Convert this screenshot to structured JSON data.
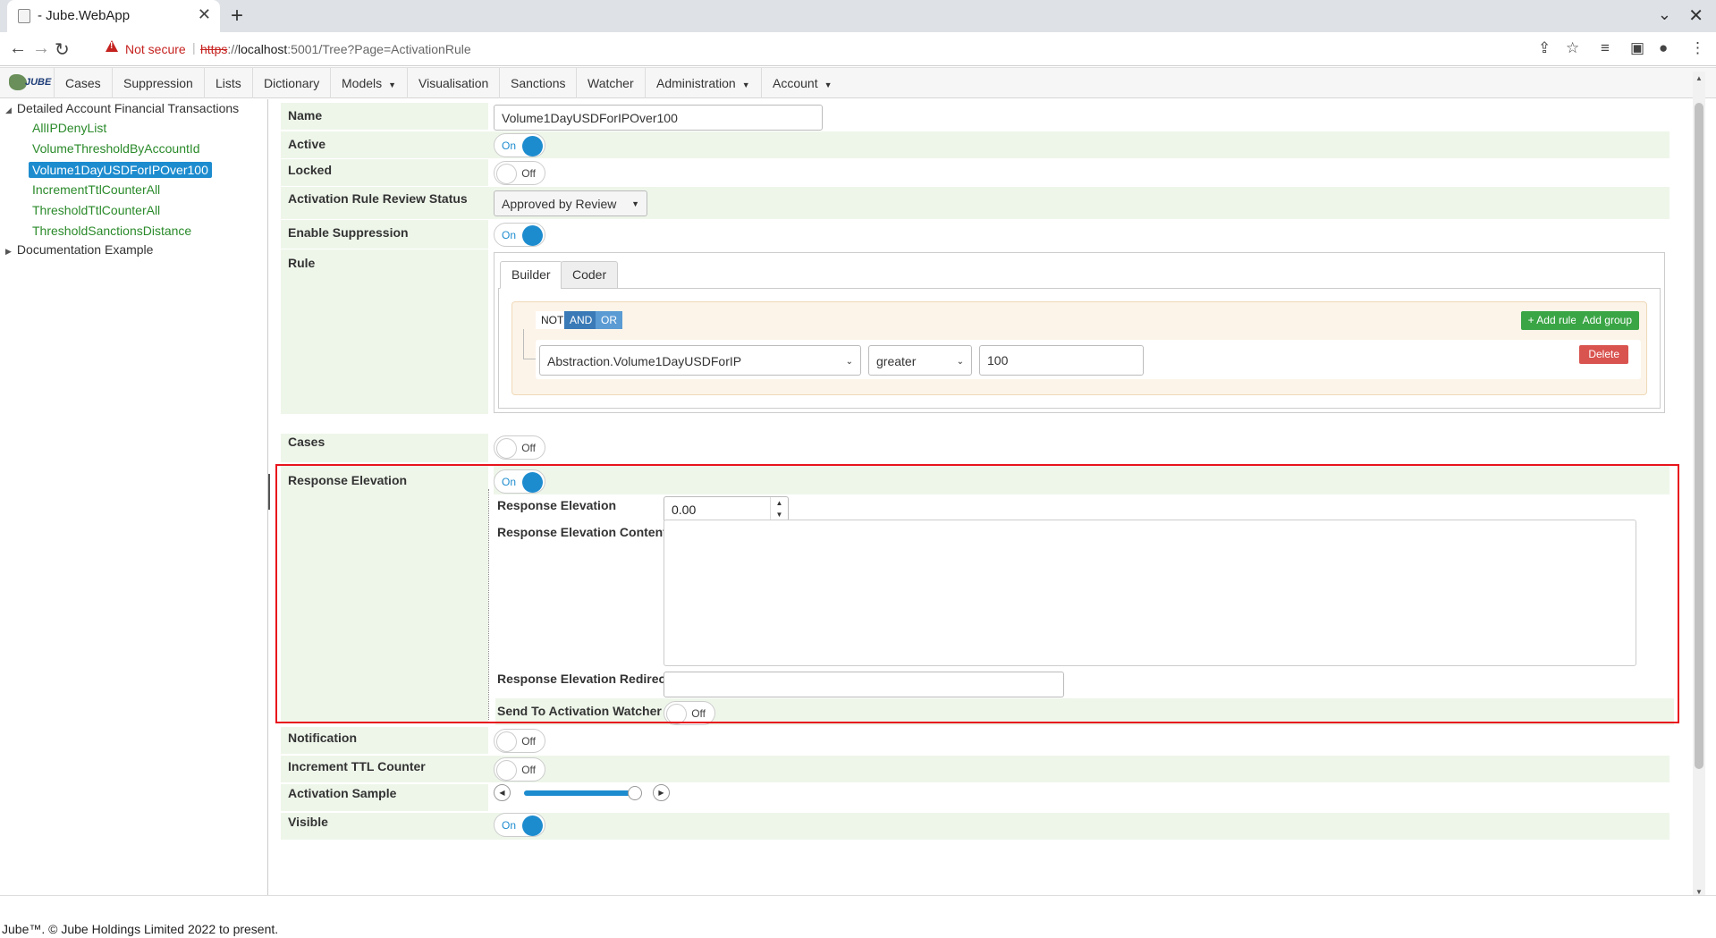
{
  "browser": {
    "tab_title": "- Jube.WebApp",
    "not_secure": "Not secure",
    "url_scheme": "https",
    "url_sep": "://",
    "url_host": "localhost",
    "url_rest": ":5001/Tree?Page=ActivationRule"
  },
  "app": {
    "logo_text": "JUBE",
    "menu": [
      {
        "label": "Cases",
        "dropdown": false
      },
      {
        "label": "Suppression",
        "dropdown": false
      },
      {
        "label": "Lists",
        "dropdown": false
      },
      {
        "label": "Dictionary",
        "dropdown": false
      },
      {
        "label": "Models",
        "dropdown": true
      },
      {
        "label": "Visualisation",
        "dropdown": false
      },
      {
        "label": "Sanctions",
        "dropdown": false
      },
      {
        "label": "Watcher",
        "dropdown": false
      },
      {
        "label": "Administration",
        "dropdown": true
      },
      {
        "label": "Account",
        "dropdown": true
      }
    ]
  },
  "tree": {
    "parent1": "Detailed Account Financial Transactions",
    "items": [
      "AllIPDenyList",
      "VolumeThresholdByAccountId",
      "Volume1DayUSDForIPOver100",
      "IncrementTtlCounterAll",
      "ThresholdTtlCounterAll",
      "ThresholdSanctionsDistance"
    ],
    "selected_index": 2,
    "parent2": "Documentation Example"
  },
  "form": {
    "name_label": "Name",
    "name_value": "Volume1DayUSDForIPOver100",
    "active_label": "Active",
    "locked_label": "Locked",
    "review_label": "Activation Rule Review Status",
    "review_value": "Approved by Review",
    "suppression_label": "Enable Suppression",
    "rule_label": "Rule",
    "builder_tab": "Builder",
    "coder_tab": "Coder",
    "qb_not": "NOT",
    "qb_and": "AND",
    "qb_or": "OR",
    "qb_add_rule": "+ Add rule",
    "qb_add_group": "Add group",
    "qb_field": "Abstraction.Volume1DayUSDForIP",
    "qb_operator": "greater",
    "qb_value": "100",
    "qb_delete": "Delete",
    "cases_label": "Cases",
    "response_elevation_label": "Response Elevation",
    "response_elevation_sub_label": "Response Elevation",
    "response_elevation_value": "0.00",
    "response_elevation_content_label": "Response Elevation Content",
    "response_elevation_redirect_label": "Response Elevation Redirect",
    "send_to_watcher_label": "Send To Activation Watcher",
    "notification_label": "Notification",
    "increment_ttl_label": "Increment TTL Counter",
    "activation_sample_label": "Activation Sample",
    "activation_sample_fraction": 0.95,
    "visible_label": "Visible",
    "toggle_on": "On",
    "toggle_off": "Off"
  },
  "footer": {
    "text": "Jube™. © Jube Holdings Limited 2022 to present."
  },
  "colors": {
    "accent": "#1d8ccf",
    "highlight": "#e8141d",
    "tree_leaf": "#2a8a2a",
    "row_alt": "#eef6ea"
  }
}
